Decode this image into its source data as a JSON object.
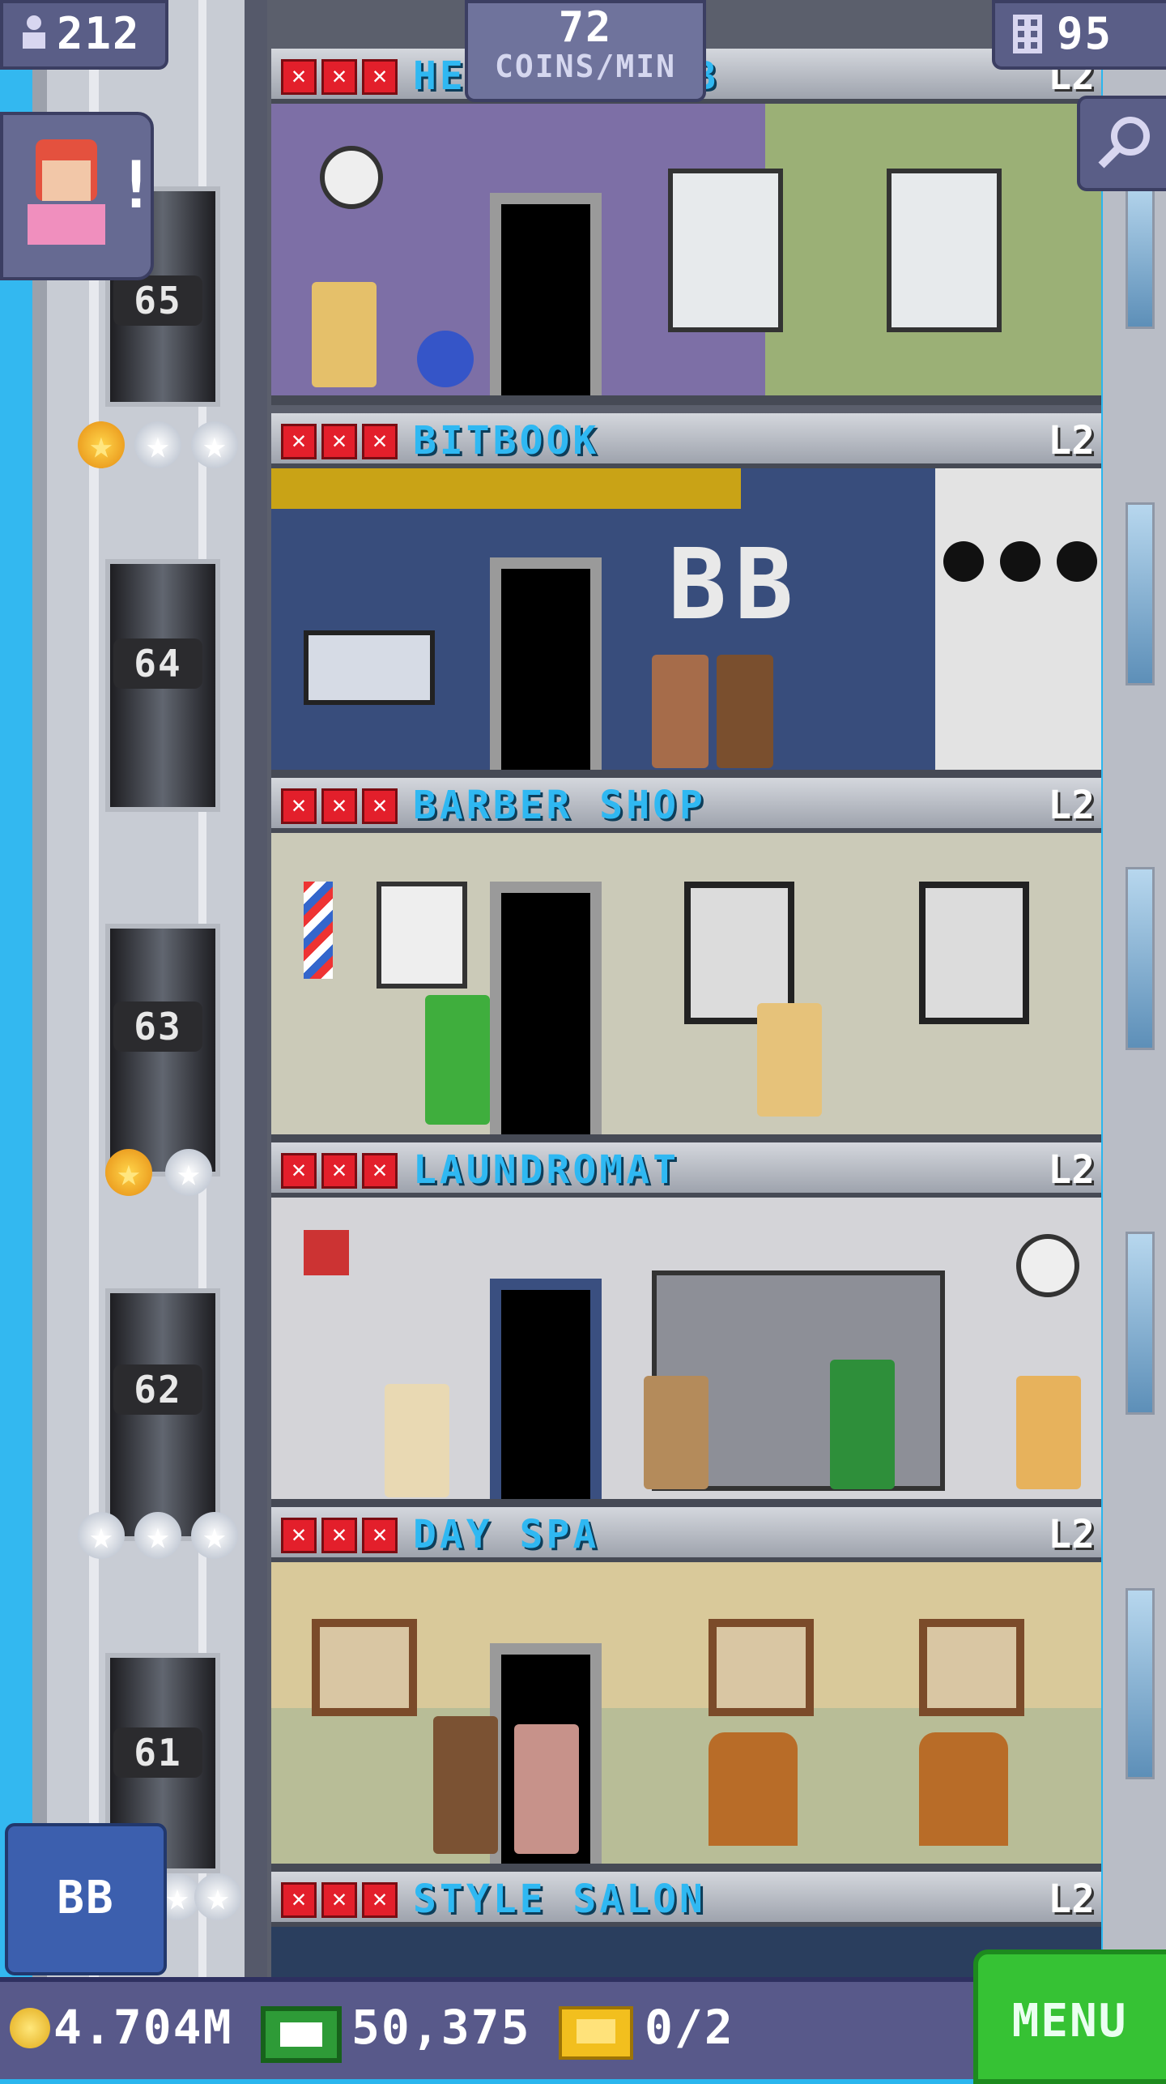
{
  "hud": {
    "population": "212",
    "coins_per_min_value": "72",
    "coins_per_min_label": "COINS/MIN",
    "floors": "95"
  },
  "notice": {
    "badge": "!"
  },
  "shortcut": {
    "label": "BB"
  },
  "bottom": {
    "coins": "4.704M",
    "bux": "50,375",
    "tickets": "0/2",
    "menu_label": "MENU"
  },
  "floors": [
    {
      "name": "HE",
      "name_tail": "B",
      "level": "L2"
    },
    {
      "name": "BITBOOK",
      "level": "L2",
      "sign": "BB"
    },
    {
      "name": "BARBER SHOP",
      "level": "L2"
    },
    {
      "name": "LAUNDROMAT",
      "level": "L2"
    },
    {
      "name": "DAY SPA",
      "level": "L2"
    },
    {
      "name": "STYLE SALON",
      "level": "L2"
    }
  ],
  "elevator_floors": [
    "65",
    "64",
    "63",
    "62",
    "61"
  ],
  "stars": [
    [
      "gold",
      "silver",
      "silver"
    ],
    [
      "gold",
      "silver"
    ],
    [
      "silver",
      "silver",
      "silver"
    ],
    [
      "silver",
      "silver"
    ]
  ],
  "colors": {
    "sky": "#2bb6ee",
    "floor_name": "#2fb8f2",
    "x_mark": "#e31f2b",
    "hud": "#5a5e87",
    "menu": "#36c234"
  },
  "icons": [
    "person-icon",
    "building-icon",
    "magnifier-icon",
    "coin-icon",
    "bux-icon",
    "ticket-icon",
    "clock-icon"
  ]
}
